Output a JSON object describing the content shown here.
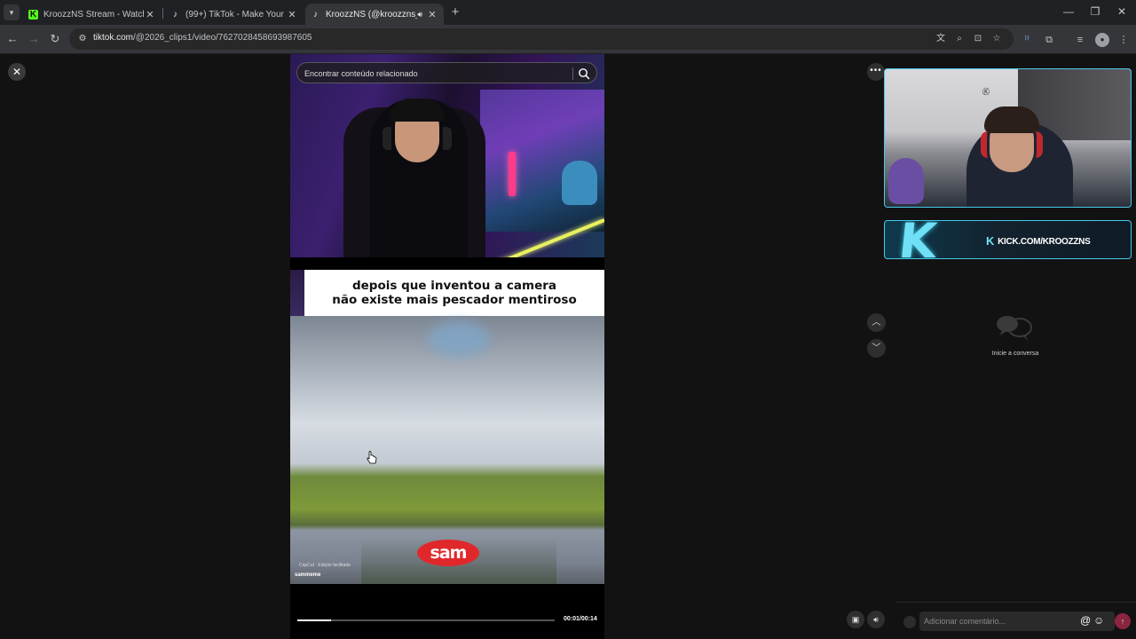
{
  "browser": {
    "tabs": [
      {
        "title": "KroozzNS Stream - Watch Live o",
        "favicon": "kick-icon",
        "active": false
      },
      {
        "title": "(99+) TikTok - Make Your Day",
        "favicon": "tiktok-icon",
        "active": false
      },
      {
        "title": "KroozzNS (@kroozzns_) | Ti",
        "favicon": "tiktok-icon",
        "active": true,
        "audio": true
      }
    ],
    "url_host": "tiktok.com",
    "url_path": "/@2026_clips1/video/7627028458693987605"
  },
  "video": {
    "search_placeholder": "Encontrar conteúdo relacionado",
    "caption_line1": "depois que inventou a camera",
    "caption_line2": "não existe mais pescador mentiroso",
    "logo_text": "sam",
    "watermark": "CapCut · Edição facilitada",
    "handle": "sammeme",
    "time": "00:01/00:14",
    "progress": 0.13
  },
  "overlay": {
    "kick_url": "KICK.COM/KROOZZNS",
    "k_letter": "K"
  },
  "comments": {
    "empty_text": "Inicie a conversa",
    "input_placeholder": "Adicionar comentário..."
  },
  "colors": {
    "accent_cyan": "#46c8e8",
    "kick_green": "#53fc18",
    "sam_red": "#e0282a"
  }
}
